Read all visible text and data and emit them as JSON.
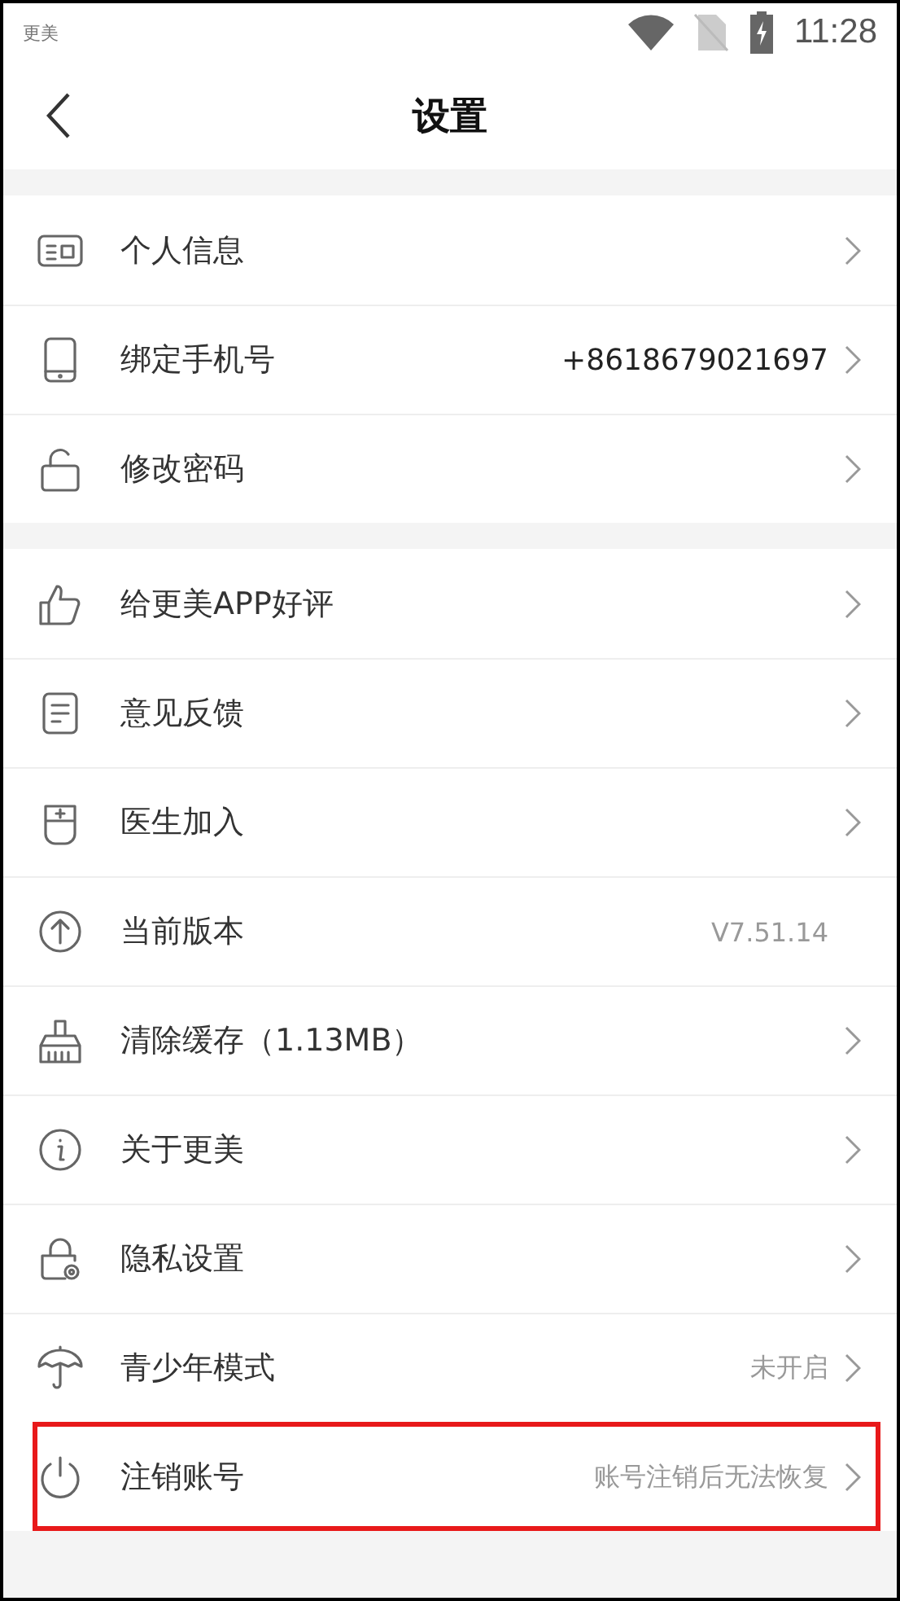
{
  "status_bar": {
    "app_label": "更美",
    "time": "11:28"
  },
  "header": {
    "title": "设置"
  },
  "groups": [
    {
      "rows": [
        {
          "label": "个人信息"
        },
        {
          "label": "绑定手机号",
          "value": "+8618679021697",
          "value_emphasis": true
        },
        {
          "label": "修改密码"
        }
      ]
    },
    {
      "rows": [
        {
          "label": "给更美APP好评"
        },
        {
          "label": "意见反馈"
        },
        {
          "label": "医生加入"
        },
        {
          "label": "当前版本",
          "value": "V7.51.14",
          "chevron": false
        },
        {
          "label": "清除缓存（1.13MB）"
        },
        {
          "label": "关于更美"
        },
        {
          "label": "隐私设置"
        },
        {
          "label": "青少年模式",
          "value": "未开启"
        },
        {
          "label": "注销账号",
          "value": "账号注销后无法恢复",
          "highlighted": true
        }
      ]
    }
  ]
}
